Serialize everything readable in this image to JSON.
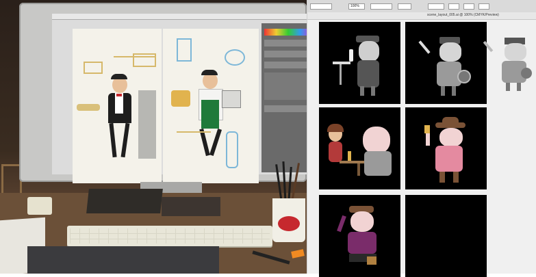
{
  "photo": {
    "description_label": "",
    "cup_logo_text": "Coca-Cola"
  },
  "storyboard": {
    "toolbar": {
      "zoom_value": "100%",
      "document_tab": "scene_layout_005.ai @ 100% (CMYK/Preview)"
    },
    "panels": [
      {
        "scene": "bar",
        "has_character": true
      },
      {
        "scene": "waving-camera",
        "has_character": true
      },
      {
        "scene": "table-conversation",
        "has_character": true
      },
      {
        "scene": "cowboy-drink",
        "has_character": true
      },
      {
        "scene": "detective-briefcase",
        "has_character": true
      },
      {
        "scene": "empty",
        "has_character": false
      }
    ]
  },
  "colors": {
    "panel_bg": "#000000",
    "board_bg": "#f0f0f0",
    "accent_red": "#c6282e",
    "pink_shirt": "#e48aa0",
    "hat_brown": "#7a5236"
  }
}
